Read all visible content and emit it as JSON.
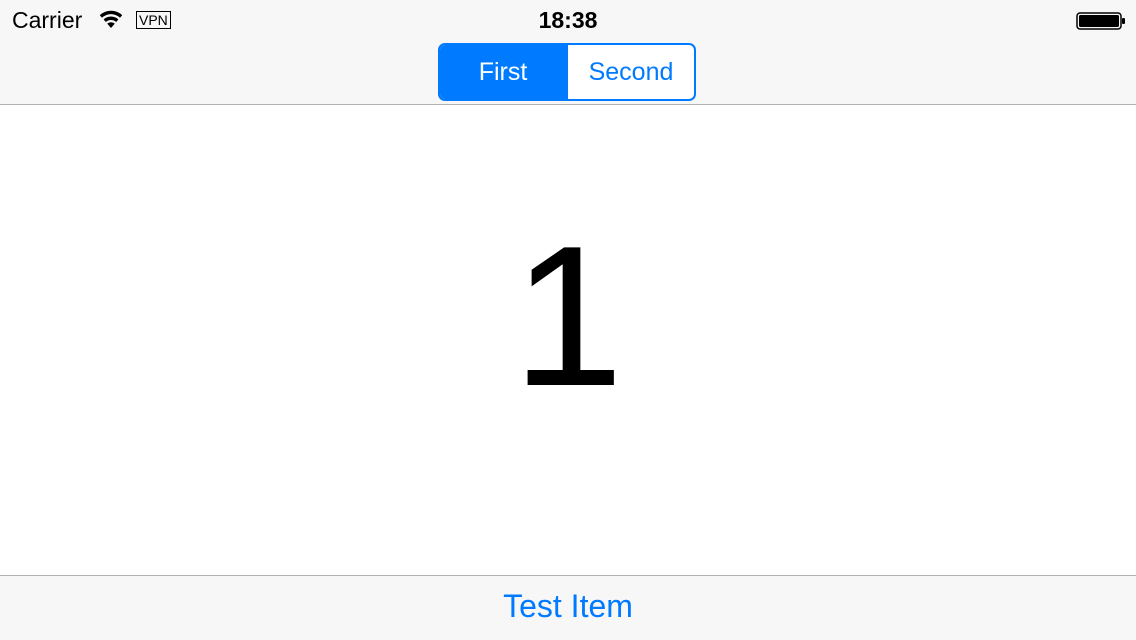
{
  "status_bar": {
    "carrier": "Carrier",
    "wifi_icon": "wifi-icon",
    "vpn": "VPN",
    "time": "18:38",
    "battery_icon": "battery-icon"
  },
  "segmented_control": {
    "segments": [
      {
        "label": "First",
        "selected": true
      },
      {
        "label": "Second",
        "selected": false
      }
    ]
  },
  "content": {
    "value": "1"
  },
  "toolbar": {
    "item_label": "Test Item"
  },
  "colors": {
    "accent": "#007aff",
    "bar_background": "#f7f7f7",
    "separator": "#b2b2b2",
    "text": "#000000"
  }
}
